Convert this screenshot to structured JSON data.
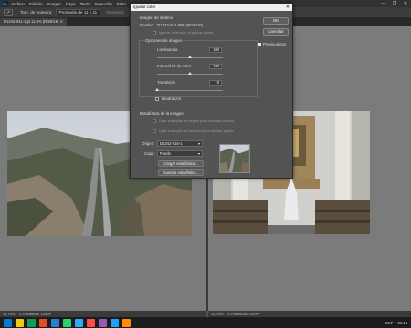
{
  "menubar": {
    "logo": "Ps",
    "items": [
      "Archivo",
      "Edición",
      "Imagen",
      "Capa",
      "Texto",
      "Selección",
      "Filtro",
      "3D"
    ],
    "window_controls": [
      "—",
      "❐",
      "✕"
    ]
  },
  "optbar": {
    "tool_icon": "↗",
    "sample_label": "Tam. de muestra:",
    "sample_value": "Promedio de 11 x 11",
    "sample_grey": "Muestras:"
  },
  "tabs": {
    "left": "D1242-041-1.pl 11,8% (RGB/16) ✕"
  },
  "dialog": {
    "title": "Igualar color",
    "close": "✕",
    "ok_label": "OK",
    "cancel_label": "Cancelar",
    "preview_label": "Previsualizar",
    "section_dest": "Imagen de destino",
    "dest_label": "Destino:",
    "dest_value": "D1242-041-RW (RGB/16)",
    "ignore_sel": "Ignorar selección al aplicar ajuste",
    "section_opts": "Opciones de imagen",
    "luminance_label": "Luminancia",
    "luminance_value": "100",
    "luminance_level": 0.5,
    "intensity_label": "Intensidad de color",
    "intensity_value": "100",
    "intensity_level": 0.5,
    "fade_label": "Transición",
    "fade_value": "0",
    "fade_level": 0,
    "neutralize_label": "Neutralizar",
    "section_stats": "Estadística de la imagen",
    "use_sel_source": "Usar selección en origen para calcular colores",
    "use_sel_dest": "Usar selección en destino para calcular ajuste",
    "source_label": "Origen:",
    "source_value": "D1242-015-1",
    "layer_label": "Capa:",
    "layer_value": "Fondo",
    "load_stats": "Cargar estadística...",
    "save_stats": "Guardar estadística..."
  },
  "status": {
    "left": "11,76%",
    "left_info": "⊙ Eficiencia: 100%*",
    "right": "11,76%",
    "right_info": "⊙ Eficiencia: 100%*"
  },
  "taskbar": {
    "lang": "ESP",
    "time": "21:14",
    "icons": [
      "#0078d7",
      "#f2c811",
      "#0f9d58",
      "#e44d26",
      "#2a7ed2",
      "#25d366",
      "#31a8ff",
      "#ff4b4b",
      "#9b59b6",
      "#1da1f2",
      "#ff8c00"
    ]
  },
  "colors": {
    "accent": "#31a8ff",
    "canvas": "#7b7b7b",
    "panel": "#535353"
  }
}
